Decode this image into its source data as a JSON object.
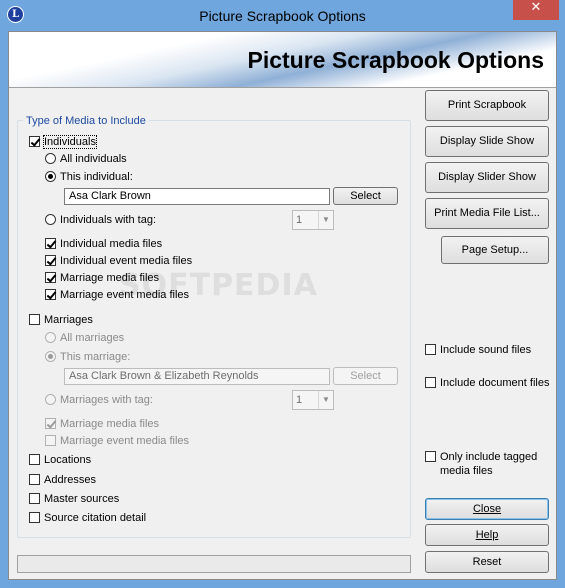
{
  "window": {
    "title": "Picture Scrapbook Options",
    "close_glyph": "✕",
    "icon_letter": "L"
  },
  "banner": {
    "title": "Picture Scrapbook Options"
  },
  "watermark": "SOFTPEDIA",
  "group": {
    "legend": "Type of Media to Include",
    "individuals": {
      "label": "Individuals",
      "all": "All individuals",
      "this": "This individual:",
      "individual_name": "Asa Clark Brown",
      "select": "Select",
      "with_tag": "Individuals with tag:",
      "tag_value": "1",
      "media_files": "Individual media files",
      "event_media_files": "Individual event media files",
      "marriage_media_files": "Marriage media files",
      "marriage_event_media_files": "Marriage event media files"
    },
    "marriages": {
      "label": "Marriages",
      "all": "All marriages",
      "this": "This marriage:",
      "marriage_name": "Asa Clark Brown & Elizabeth Reynolds",
      "select": "Select",
      "with_tag": "Marriages with tag:",
      "tag_value": "1",
      "media_files": "Marriage media files",
      "event_media_files": "Marriage event media files"
    },
    "locations": "Locations",
    "addresses": "Addresses",
    "master_sources": "Master sources",
    "source_citation_detail": "Source citation detail"
  },
  "buttons": {
    "print_scrapbook": "Print Scrapbook",
    "display_slide_show": "Display Slide Show",
    "display_slider_show": "Display Slider Show",
    "print_media_file_list": "Print Media File List...",
    "page_setup": "Page Setup...",
    "close": "Close",
    "help": "Help",
    "reset": "Reset"
  },
  "options": {
    "include_sound_files": "Include sound files",
    "include_document_files": "Include document files",
    "only_tagged_line1": "Only include tagged",
    "only_tagged_line2": "media files"
  }
}
